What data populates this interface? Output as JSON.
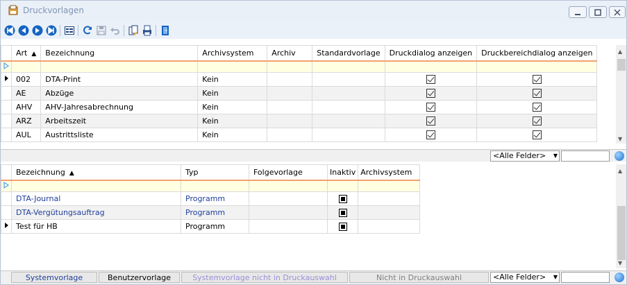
{
  "window": {
    "title": "Druckvorlagen"
  },
  "upper": {
    "headers": [
      "Art",
      "Bezeichnung",
      "Archivsystem",
      "Archiv",
      "Standardvorlage",
      "Druckdialog anzeigen",
      "Druckbereichdialog anzeigen"
    ],
    "rows": [
      {
        "art": "002",
        "bez": "DTA-Print",
        "archivsystem": "Kein",
        "archiv": "",
        "standard": "",
        "druckdialog": true,
        "druckbereich": true
      },
      {
        "art": "AE",
        "bez": "Abzüge",
        "archivsystem": "Kein",
        "archiv": "",
        "standard": "",
        "druckdialog": true,
        "druckbereich": true
      },
      {
        "art": "AHV",
        "bez": "AHV-Jahresabrechnung",
        "archivsystem": "Kein",
        "archiv": "",
        "standard": "",
        "druckdialog": true,
        "druckbereich": true
      },
      {
        "art": "ARZ",
        "bez": "Arbeitszeit",
        "archivsystem": "Kein",
        "archiv": "",
        "standard": "",
        "druckdialog": true,
        "druckbereich": true
      },
      {
        "art": "AUL",
        "bez": "Austrittsliste",
        "archivsystem": "Kein",
        "archiv": "",
        "standard": "",
        "druckdialog": true,
        "druckbereich": true
      }
    ],
    "filter": "<Alle Felder>"
  },
  "lower": {
    "headers": [
      "Bezeichnung",
      "Typ",
      "Folgevorlage",
      "Inaktiv",
      "Archivsystem"
    ],
    "rows": [
      {
        "bez": "DTA-Journal",
        "typ": "Programm",
        "folge": "",
        "inaktiv": true,
        "archivsystem": "",
        "blue": true
      },
      {
        "bez": "DTA-Vergütungsauftrag",
        "typ": "Programm",
        "folge": "",
        "inaktiv": true,
        "archivsystem": "",
        "blue": true
      },
      {
        "bez": "Test für HB",
        "typ": "Programm",
        "folge": "",
        "inaktiv": true,
        "archivsystem": "",
        "blue": false
      }
    ],
    "filter": "<Alle Felder>"
  },
  "legend": {
    "system": "Systemvorlage",
    "benutzer": "Benutzervorlage",
    "system_nicht": "Systemvorlage nicht in Druckauswahl",
    "nicht": "Nicht in Druckauswahl"
  },
  "colors": {
    "system_text": "#1f3e99",
    "system_nicht_text": "#9b8fd6",
    "nicht_text": "#808080"
  }
}
